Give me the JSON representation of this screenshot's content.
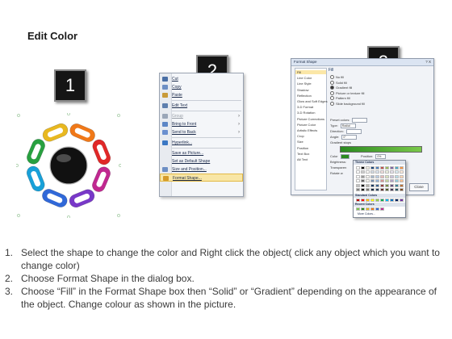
{
  "title": "Edit Color",
  "step_badges": [
    "1",
    "2",
    "3"
  ],
  "ring": {
    "link_colors": [
      "#e8b820",
      "#f07818",
      "#e02828",
      "#c02890",
      "#7838c8",
      "#3068d8",
      "#18a0d8",
      "#28a040"
    ],
    "center_color": "#111111"
  },
  "context_menu": {
    "items": [
      {
        "label": "Cut",
        "icon": "scissors-icon",
        "type": "item"
      },
      {
        "label": "Copy",
        "icon": "copy-icon",
        "type": "item"
      },
      {
        "label": "Paste",
        "icon": "paste-icon",
        "type": "item"
      },
      {
        "type": "separator"
      },
      {
        "label": "Edit Text",
        "icon": "edit-text-icon",
        "type": "item"
      },
      {
        "type": "separator"
      },
      {
        "label": "Group",
        "icon": "group-icon",
        "type": "disabled",
        "submenu": true
      },
      {
        "label": "Bring to Front",
        "icon": "bring-front-icon",
        "type": "item",
        "submenu": true
      },
      {
        "label": "Send to Back",
        "icon": "send-back-icon",
        "type": "item",
        "submenu": true
      },
      {
        "type": "separator"
      },
      {
        "label": "Hyperlink...",
        "icon": "hyperlink-icon",
        "type": "item"
      },
      {
        "type": "separator"
      },
      {
        "label": "Save as Picture...",
        "icon": "",
        "type": "item"
      },
      {
        "label": "Set as Default Shape",
        "icon": "",
        "type": "item"
      },
      {
        "label": "Size and Position...",
        "icon": "size-icon",
        "type": "item"
      },
      {
        "label": "Format Shape...",
        "icon": "format-icon",
        "type": "highlight"
      }
    ]
  },
  "dialog": {
    "title": "Format Shape",
    "title_buttons": "? X",
    "categories": [
      "Fill",
      "Line Color",
      "Line Style",
      "Shadow",
      "Reflection",
      "Glow and Soft Edges",
      "3-D Format",
      "3-D Rotation",
      "Picture Corrections",
      "Picture Color",
      "Artistic Effects",
      "Crop",
      "Size",
      "Position",
      "Text Box",
      "Alt Text"
    ],
    "selected_category": "Fill",
    "pane_heading": "Fill",
    "fill_options": [
      "No fill",
      "Solid fill",
      "Gradient fill",
      "Picture or texture fill",
      "Pattern fill",
      "Slide background fill"
    ],
    "selected_fill": "Gradient fill",
    "fields": {
      "preset_label": "Preset colors:",
      "type_label": "Type:",
      "type_value": "Radial",
      "direction_label": "Direction:",
      "angle_label": "Angle:",
      "angle_value": "0°",
      "stops_label": "Gradient stops",
      "color_label": "Color",
      "position_label": "Position:",
      "position_value": "0%",
      "brightness_label": "Brightness:",
      "transparency_label": "Transparen",
      "rotate_label": "Rotate w"
    },
    "close_label": "Close"
  },
  "palette": {
    "theme_header": "Theme Colors",
    "standard_header": "Standard Colors",
    "recent_header": "Recent Colors",
    "more_label": "More Colors...",
    "theme_top": [
      "#ffffff",
      "#000000",
      "#eeece1",
      "#1f497d",
      "#4f81bd",
      "#c0504d",
      "#9bbb59",
      "#8064a2",
      "#4bacc6",
      "#f79646"
    ],
    "standard": [
      "#c00000",
      "#ff0000",
      "#ffc000",
      "#ffff00",
      "#92d050",
      "#00b050",
      "#00b0f0",
      "#0070c0",
      "#002060",
      "#7030a0"
    ],
    "recent": [
      "#7bc94b",
      "#2a8a1f",
      "#e8b820",
      "#f07818",
      "#3068d8",
      "#c02890"
    ]
  },
  "instructions": [
    {
      "num": "1.",
      "text": "Select the shape to change the color and Right click the object( click any object which you want to change color)"
    },
    {
      "num": "2.",
      "text": "Choose Format Shape in the dialog box."
    },
    {
      "num": "3.",
      "text": "Choose “Fill” in the Format Shape box then “Solid” or “Gradient” depending on the appearance of the object. Change colour as shown in the picture."
    }
  ]
}
